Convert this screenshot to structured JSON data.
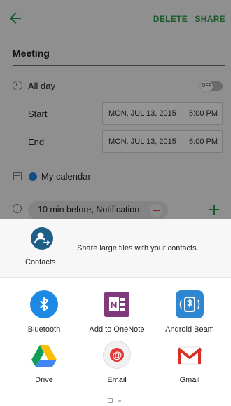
{
  "topbar": {
    "delete_label": "DELETE",
    "share_label": "SHARE"
  },
  "event": {
    "title": "Meeting",
    "all_day_label": "All day",
    "all_day_toggle": "OFF",
    "start_label": "Start",
    "start_date": "MON, JUL 13, 2015",
    "start_time": "5:00 PM",
    "end_label": "End",
    "end_date": "MON, JUL 13, 2015",
    "end_time": "6:00 PM",
    "calendar_label": "My calendar",
    "reminder_text": "10 min before, Notification"
  },
  "share_sheet": {
    "direct_share": {
      "label": "Contacts",
      "description": "Share large files with your contacts."
    },
    "apps": [
      {
        "label": "Bluetooth",
        "icon": "bluetooth-icon",
        "color": "#1e88e5"
      },
      {
        "label": "Add to OneNote",
        "icon": "onenote-icon",
        "color": "#80397b"
      },
      {
        "label": "Android Beam",
        "icon": "android-beam-icon",
        "color": "#2f86d1"
      },
      {
        "label": "Drive",
        "icon": "google-drive-icon",
        "color": "#ffffff"
      },
      {
        "label": "Email",
        "icon": "email-icon",
        "color": "#e53935"
      },
      {
        "label": "Gmail",
        "icon": "gmail-icon",
        "color": "#ffffff"
      }
    ]
  },
  "colors": {
    "accent_green": "#2e9b49",
    "calendar_blue": "#1e88e5",
    "remove_red": "#e53935"
  }
}
